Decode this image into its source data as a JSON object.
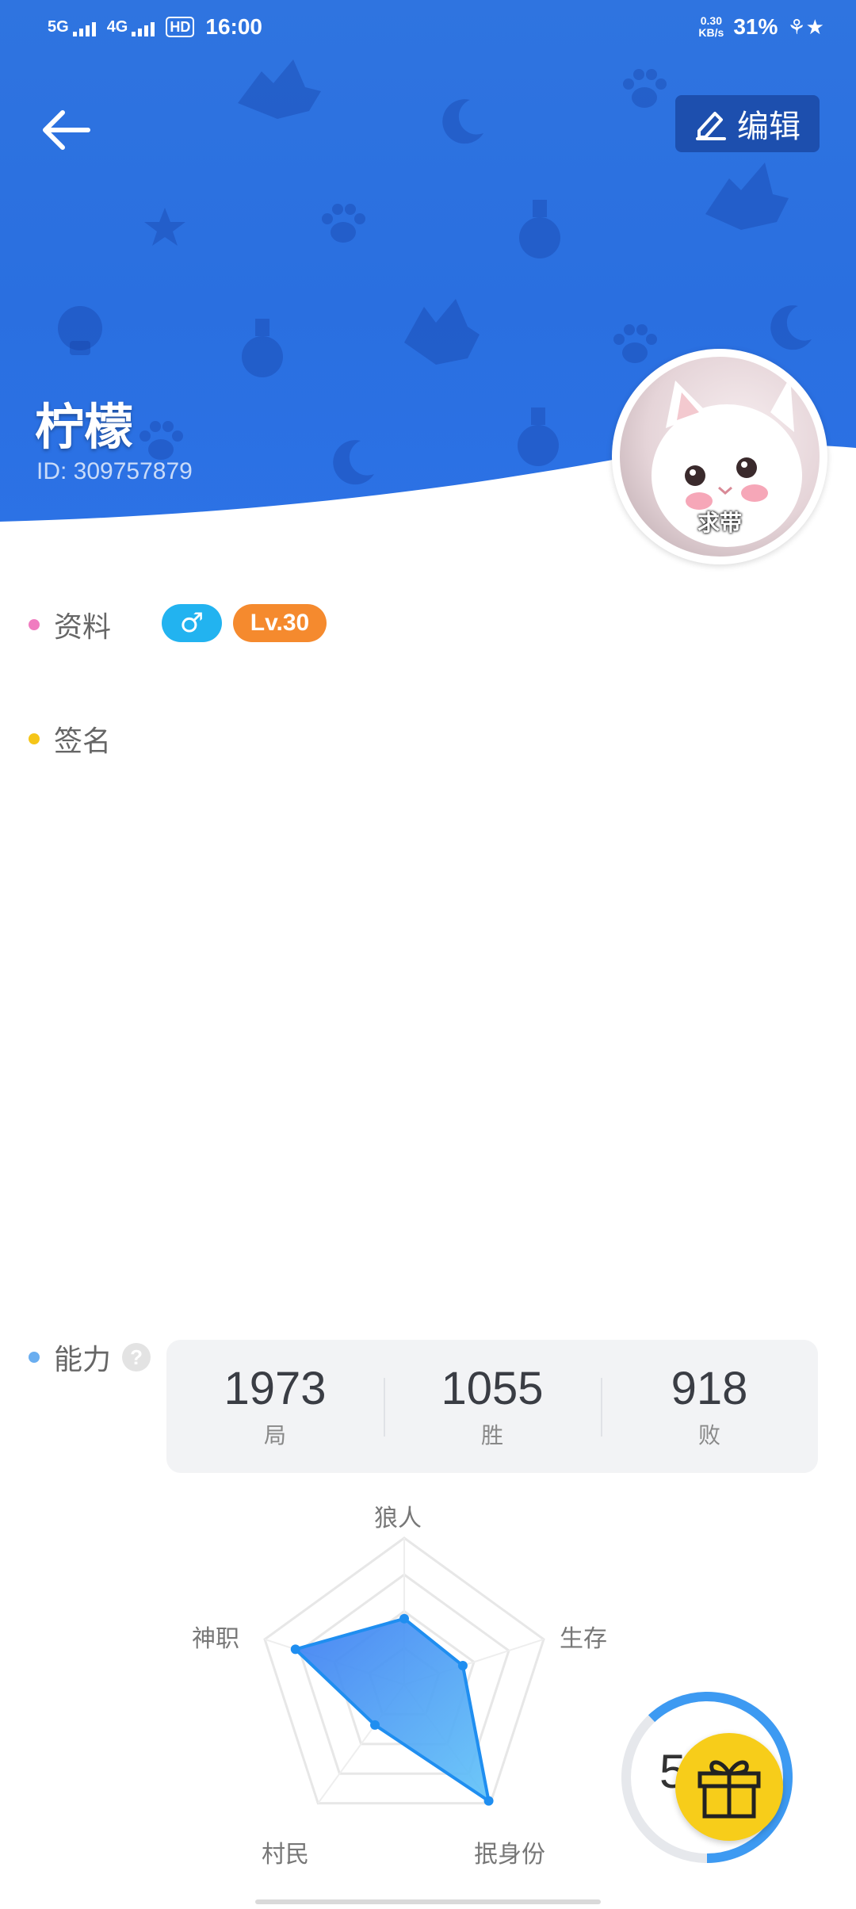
{
  "status_bar": {
    "net1": "5G",
    "net2": "4G",
    "hd": "HD",
    "time": "16:00",
    "speed_value": "0.30",
    "speed_unit": "KB/s",
    "battery": "31%"
  },
  "header": {
    "edit_label": "编辑",
    "nickname": "柠檬",
    "user_id": "ID: 309757879",
    "avatar_caption": "求带"
  },
  "profile": {
    "label": "资料",
    "gender_symbol": "♂",
    "level": "Lv.30"
  },
  "signature": {
    "label": "签名"
  },
  "ability": {
    "label": "能力",
    "help": "?",
    "stats": [
      {
        "value": "1973",
        "label": "局"
      },
      {
        "value": "1055",
        "label": "胜"
      },
      {
        "value": "918",
        "label": "败"
      }
    ],
    "radar_axes": [
      "狼人",
      "生存",
      "抿身份",
      "村民",
      "神职"
    ],
    "radar_values": [
      0.45,
      0.42,
      0.98,
      0.34,
      0.78
    ]
  },
  "gift": {
    "ring_number": "5",
    "progress": 0.62
  },
  "colors": {
    "header_blue": "#2f74e0",
    "edit_bg": "#1d4fae",
    "dot_profile": "#f07cc0",
    "dot_signature": "#f5c518",
    "dot_ability": "#6aaef0",
    "gender_badge": "#22b3f0",
    "level_badge": "#f58a2e",
    "gift_yellow": "#f7cd1a"
  }
}
